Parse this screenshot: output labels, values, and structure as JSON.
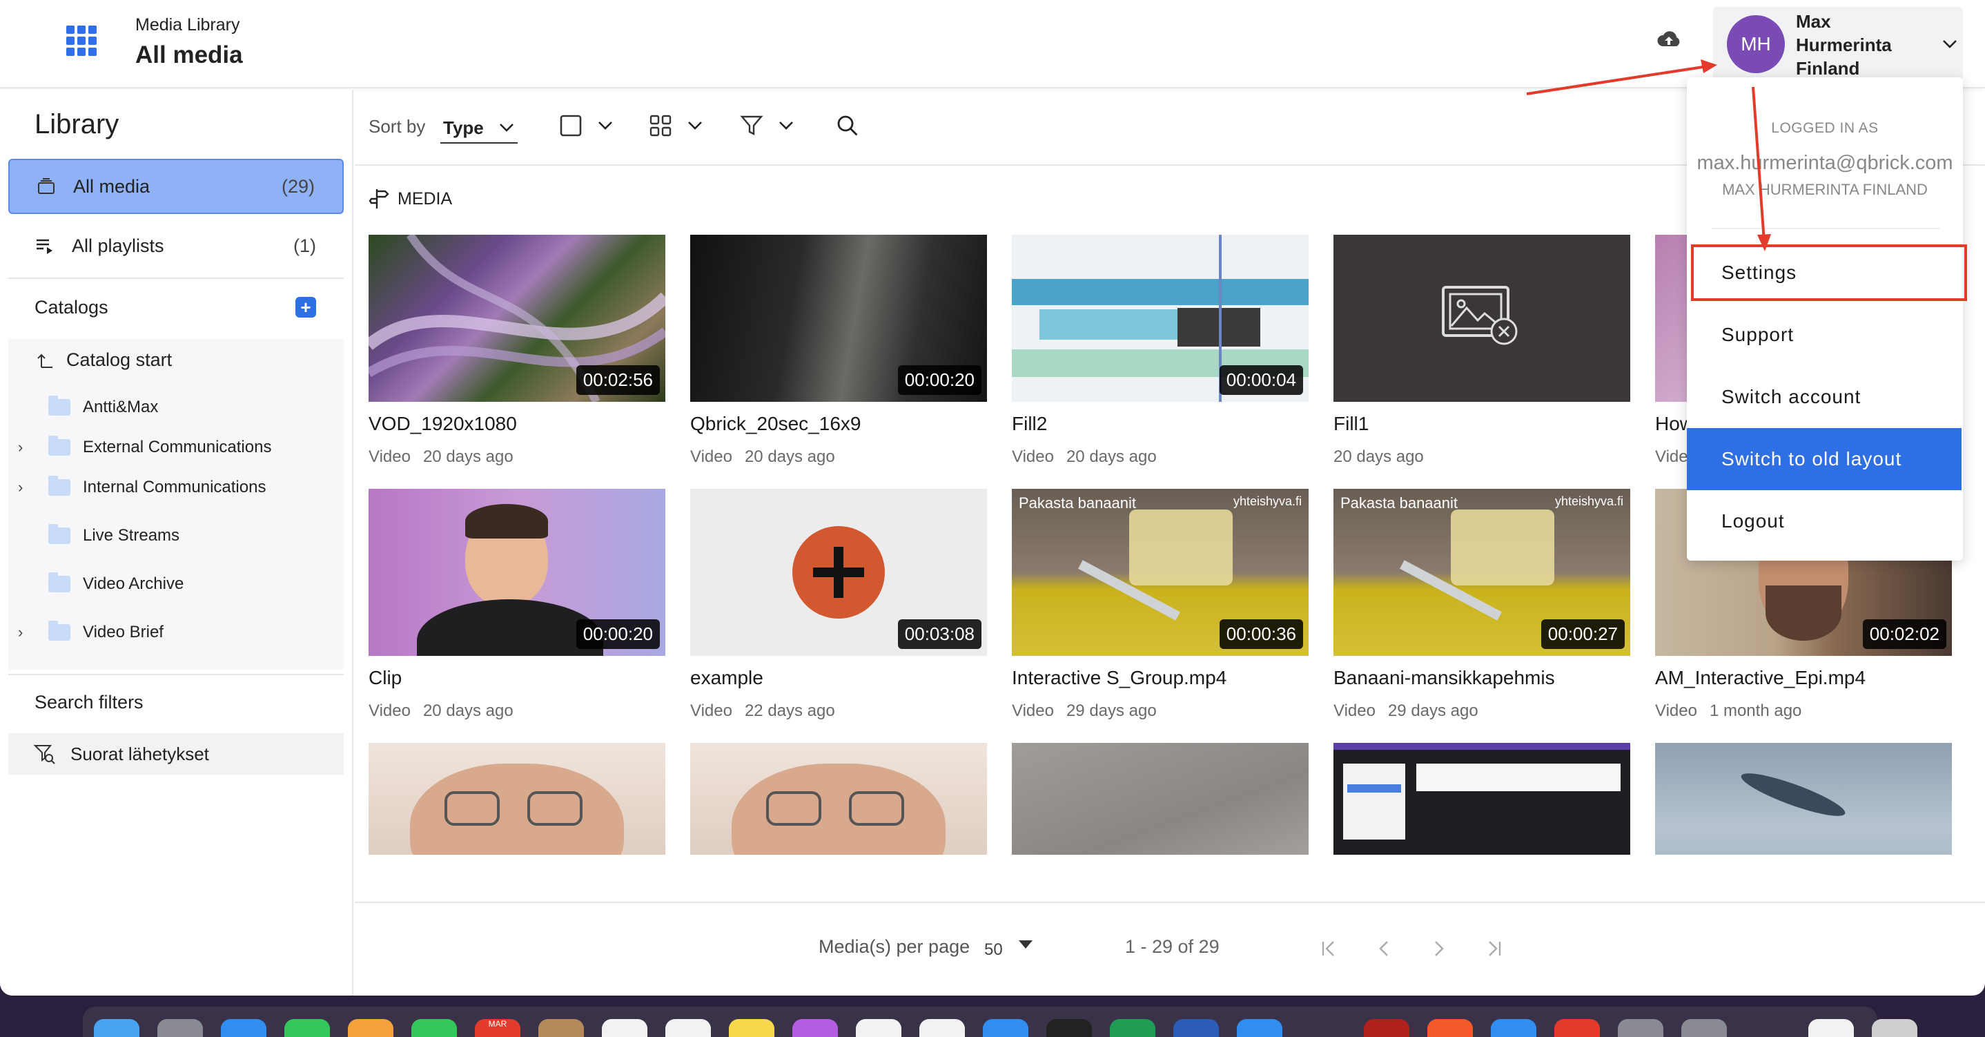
{
  "header": {
    "subtitle": "Media Library",
    "title": "All media",
    "apps_icon": "apps-grid-icon",
    "upload_icon": "cloud-upload-icon",
    "user": {
      "initials": "MH",
      "name_line1": "Max",
      "name_line2": "Hurmerinta",
      "name_line3": "Finland",
      "avatar_color": "#7b4bb5"
    }
  },
  "sidebar": {
    "title": "Library",
    "items": [
      {
        "label": "All media",
        "count": "(29)",
        "icon": "media-icon"
      },
      {
        "label": "All playlists",
        "count": "(1)",
        "icon": "playlist-icon"
      }
    ],
    "catalogs_label": "Catalogs",
    "catalog_start": "Catalog start",
    "folders": [
      {
        "label": "Antti&Max",
        "expandable": false
      },
      {
        "label": "External Communications",
        "expandable": true
      },
      {
        "label": "Internal Communications",
        "expandable": true
      },
      {
        "label": "Live Streams",
        "expandable": false
      },
      {
        "label": "Video Archive",
        "expandable": false
      },
      {
        "label": "Video Brief",
        "expandable": true
      }
    ],
    "search_filters_label": "Search filters",
    "saved_filter": "Suorat lähetykset"
  },
  "toolbar": {
    "sort_label": "Sort by",
    "sort_value": "Type"
  },
  "content": {
    "section_label": "MEDIA",
    "cards": [
      {
        "title": "VOD_1920x1080",
        "type": "Video",
        "age": "20 days ago",
        "duration": "00:02:56"
      },
      {
        "title": "Qbrick_20sec_16x9",
        "type": "Video",
        "age": "20 days ago",
        "duration": "00:00:20"
      },
      {
        "title": "Fill2",
        "type": "Video",
        "age": "20 days ago",
        "duration": "00:00:04"
      },
      {
        "title": "Fill1",
        "type": "",
        "age": "20 days ago",
        "duration": ""
      },
      {
        "title": "How",
        "type": "Vide",
        "age": "",
        "duration": ""
      },
      {
        "title": "Clip",
        "type": "Video",
        "age": "20 days ago",
        "duration": "00:00:20"
      },
      {
        "title": "example",
        "type": "Video",
        "age": "22 days ago",
        "duration": "00:03:08"
      },
      {
        "title": "Interactive S_Group.mp4",
        "type": "Video",
        "age": "29 days ago",
        "duration": "00:00:36"
      },
      {
        "title": "Banaani-mansikkapehmis",
        "type": "Video",
        "age": "29 days ago",
        "duration": "00:00:27"
      },
      {
        "title": "AM_Interactive_Epi.mp4",
        "type": "Video",
        "age": "1 month ago",
        "duration": "00:02:02"
      }
    ],
    "overlay_text": "Pakasta banaanit",
    "overlay_brand": "yhteishyva.fi"
  },
  "footer": {
    "per_page_label": "Media(s) per page",
    "per_page_value": "50",
    "range": "1 - 29 of 29"
  },
  "menu": {
    "logged_in_as": "LOGGED IN AS",
    "email": "max.hurmerinta@qbrick.com",
    "account_name": "MAX HURMERINTA FINLAND",
    "items": [
      "Settings",
      "Support",
      "Switch account",
      "Switch to old layout",
      "Logout"
    ],
    "highlight_color": "#2f6fe4"
  },
  "dock": {
    "calendar_month": "MAR"
  }
}
